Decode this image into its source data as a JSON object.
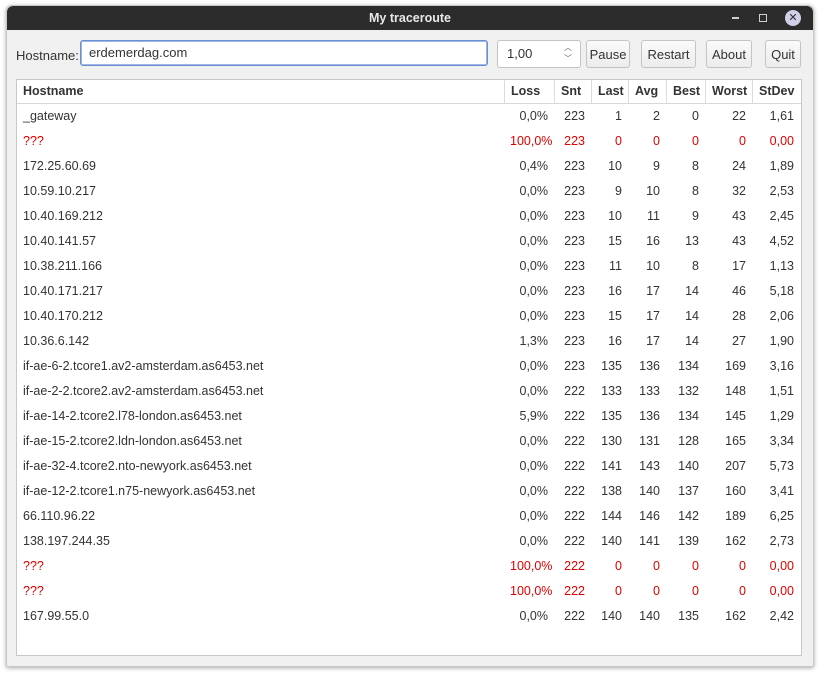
{
  "window": {
    "title": "My traceroute"
  },
  "toolbar": {
    "hostname_label": "Hostname:",
    "hostname_value": "erdemerdag.com",
    "interval_value": "1,00",
    "pause_label": "Pause",
    "restart_label": "Restart",
    "about_label": "About",
    "quit_label": "Quit"
  },
  "table": {
    "headers": {
      "hostname": "Hostname",
      "loss": "Loss",
      "snt": "Snt",
      "last": "Last",
      "avg": "Avg",
      "best": "Best",
      "worst": "Worst",
      "stdev": "StDev"
    },
    "rows": [
      {
        "host": "_gateway",
        "loss": "0,0%",
        "snt": "223",
        "last": "1",
        "avg": "2",
        "best": "0",
        "worst": "22",
        "stdev": "1,61"
      },
      {
        "host": "???",
        "loss": "100,0%",
        "snt": "223",
        "last": "0",
        "avg": "0",
        "best": "0",
        "worst": "0",
        "stdev": "0,00"
      },
      {
        "host": "172.25.60.69",
        "loss": "0,4%",
        "snt": "223",
        "last": "10",
        "avg": "9",
        "best": "8",
        "worst": "24",
        "stdev": "1,89"
      },
      {
        "host": "10.59.10.217",
        "loss": "0,0%",
        "snt": "223",
        "last": "9",
        "avg": "10",
        "best": "8",
        "worst": "32",
        "stdev": "2,53"
      },
      {
        "host": "10.40.169.212",
        "loss": "0,0%",
        "snt": "223",
        "last": "10",
        "avg": "11",
        "best": "9",
        "worst": "43",
        "stdev": "2,45"
      },
      {
        "host": "10.40.141.57",
        "loss": "0,0%",
        "snt": "223",
        "last": "15",
        "avg": "16",
        "best": "13",
        "worst": "43",
        "stdev": "4,52"
      },
      {
        "host": "10.38.211.166",
        "loss": "0,0%",
        "snt": "223",
        "last": "11",
        "avg": "10",
        "best": "8",
        "worst": "17",
        "stdev": "1,13"
      },
      {
        "host": "10.40.171.217",
        "loss": "0,0%",
        "snt": "223",
        "last": "16",
        "avg": "17",
        "best": "14",
        "worst": "46",
        "stdev": "5,18"
      },
      {
        "host": "10.40.170.212",
        "loss": "0,0%",
        "snt": "223",
        "last": "15",
        "avg": "17",
        "best": "14",
        "worst": "28",
        "stdev": "2,06"
      },
      {
        "host": "10.36.6.142",
        "loss": "1,3%",
        "snt": "223",
        "last": "16",
        "avg": "17",
        "best": "14",
        "worst": "27",
        "stdev": "1,90"
      },
      {
        "host": "if-ae-6-2.tcore1.av2-amsterdam.as6453.net",
        "loss": "0,0%",
        "snt": "223",
        "last": "135",
        "avg": "136",
        "best": "134",
        "worst": "169",
        "stdev": "3,16"
      },
      {
        "host": "if-ae-2-2.tcore2.av2-amsterdam.as6453.net",
        "loss": "0,0%",
        "snt": "222",
        "last": "133",
        "avg": "133",
        "best": "132",
        "worst": "148",
        "stdev": "1,51"
      },
      {
        "host": "if-ae-14-2.tcore2.l78-london.as6453.net",
        "loss": "5,9%",
        "snt": "222",
        "last": "135",
        "avg": "136",
        "best": "134",
        "worst": "145",
        "stdev": "1,29"
      },
      {
        "host": "if-ae-15-2.tcore2.ldn-london.as6453.net",
        "loss": "0,0%",
        "snt": "222",
        "last": "130",
        "avg": "131",
        "best": "128",
        "worst": "165",
        "stdev": "3,34"
      },
      {
        "host": "if-ae-32-4.tcore2.nto-newyork.as6453.net",
        "loss": "0,0%",
        "snt": "222",
        "last": "141",
        "avg": "143",
        "best": "140",
        "worst": "207",
        "stdev": "5,73"
      },
      {
        "host": "if-ae-12-2.tcore1.n75-newyork.as6453.net",
        "loss": "0,0%",
        "snt": "222",
        "last": "138",
        "avg": "140",
        "best": "137",
        "worst": "160",
        "stdev": "3,41"
      },
      {
        "host": "66.110.96.22",
        "loss": "0,0%",
        "snt": "222",
        "last": "144",
        "avg": "146",
        "best": "142",
        "worst": "189",
        "stdev": "6,25"
      },
      {
        "host": "138.197.244.35",
        "loss": "0,0%",
        "snt": "222",
        "last": "140",
        "avg": "141",
        "best": "139",
        "worst": "162",
        "stdev": "2,73"
      },
      {
        "host": "???",
        "loss": "100,0%",
        "snt": "222",
        "last": "0",
        "avg": "0",
        "best": "0",
        "worst": "0",
        "stdev": "0,00"
      },
      {
        "host": "???",
        "loss": "100,0%",
        "snt": "222",
        "last": "0",
        "avg": "0",
        "best": "0",
        "worst": "0",
        "stdev": "0,00"
      },
      {
        "host": "167.99.55.0",
        "loss": "0,0%",
        "snt": "222",
        "last": "140",
        "avg": "140",
        "best": "135",
        "worst": "162",
        "stdev": "2,42"
      }
    ]
  },
  "colors": {
    "lost_row": "#e00000",
    "titlebar": "#2c2c2c",
    "input_focus": "#6b8fcf"
  }
}
